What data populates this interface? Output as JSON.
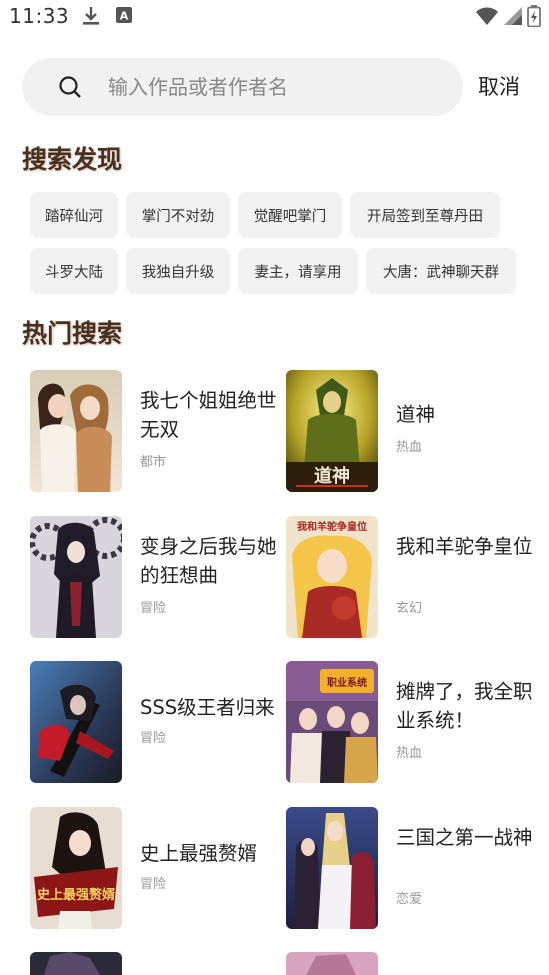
{
  "status_bar": {
    "time": "11:33",
    "a_badge": "A"
  },
  "search": {
    "placeholder": "输入作品或者作者名",
    "value": "",
    "cancel_label": "取消"
  },
  "discover": {
    "title": "搜索发现",
    "tags": [
      "踏碎仙河",
      "掌门不对劲",
      "觉醒吧掌门",
      "开局签到至尊丹田",
      "斗罗大陆",
      "我独自升级",
      "妻主，请享用",
      "大唐：武神聊天群"
    ]
  },
  "hot": {
    "title": "热门搜索",
    "items": [
      {
        "title": "我七个姐姐绝世无双",
        "genre": "都市"
      },
      {
        "title": "道神",
        "genre": "热血",
        "cover_text": "道神"
      },
      {
        "title": "变身之后我与她的狂想曲",
        "genre": "冒险"
      },
      {
        "title": "我和羊驼争皇位",
        "genre": "玄幻",
        "cover_text": "我和羊驼争皇位"
      },
      {
        "title": "SSS级王者归来",
        "genre": "冒险"
      },
      {
        "title": "摊牌了，我全职业系统！",
        "genre": "热血",
        "cover_text": "职业系统"
      },
      {
        "title": "史上最强赘婿",
        "genre": "冒险",
        "cover_text": "史上最强赘婿"
      },
      {
        "title": "三国之第一战神",
        "genre": "恋爱"
      }
    ]
  },
  "colors": {
    "section_title": "#4a2f20",
    "tag_bg": "#f2f2f2",
    "search_bg": "#f1f1f1",
    "genre": "#999999"
  }
}
